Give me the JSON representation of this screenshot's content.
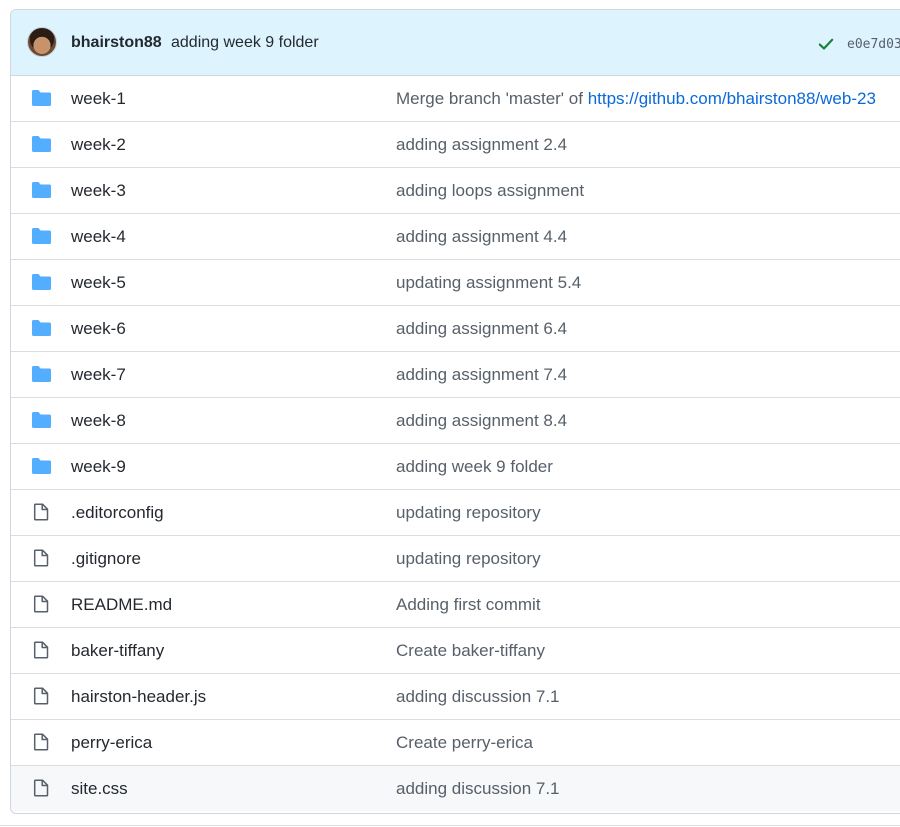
{
  "commit": {
    "author": "bhairston88",
    "message": "adding week 9 folder",
    "sha": "e0e7d03"
  },
  "files": [
    {
      "name": "week-1",
      "type": "folder",
      "message_prefix": "Merge branch 'master' of ",
      "message_link": "https://github.com/bhairston88/web-23"
    },
    {
      "name": "week-2",
      "type": "folder",
      "message": "adding assignment 2.4"
    },
    {
      "name": "week-3",
      "type": "folder",
      "message": "adding loops assignment"
    },
    {
      "name": "week-4",
      "type": "folder",
      "message": "adding assignment 4.4"
    },
    {
      "name": "week-5",
      "type": "folder",
      "message": "updating assignment 5.4"
    },
    {
      "name": "week-6",
      "type": "folder",
      "message": "adding assignment 6.4"
    },
    {
      "name": "week-7",
      "type": "folder",
      "message": "adding assignment 7.4"
    },
    {
      "name": "week-8",
      "type": "folder",
      "message": "adding assignment 8.4"
    },
    {
      "name": "week-9",
      "type": "folder",
      "message": "adding week 9 folder"
    },
    {
      "name": ".editorconfig",
      "type": "file",
      "message": "updating repository"
    },
    {
      "name": ".gitignore",
      "type": "file",
      "message": "updating repository"
    },
    {
      "name": "README.md",
      "type": "file",
      "message": "Adding first commit"
    },
    {
      "name": "baker-tiffany",
      "type": "file",
      "message": "Create baker-tiffany"
    },
    {
      "name": "hairston-header.js",
      "type": "file",
      "message": "adding discussion 7.1"
    },
    {
      "name": "perry-erica",
      "type": "file",
      "message": "Create perry-erica"
    },
    {
      "name": "site.css",
      "type": "file",
      "message": "adding discussion 7.1"
    }
  ],
  "icons": {
    "folder": "folder-icon",
    "file": "file-icon",
    "check": "check-icon"
  },
  "colors": {
    "folder": "#54aeff",
    "link": "#0969da",
    "check": "#1a7f37",
    "commit_bg": "#ddf4ff"
  }
}
